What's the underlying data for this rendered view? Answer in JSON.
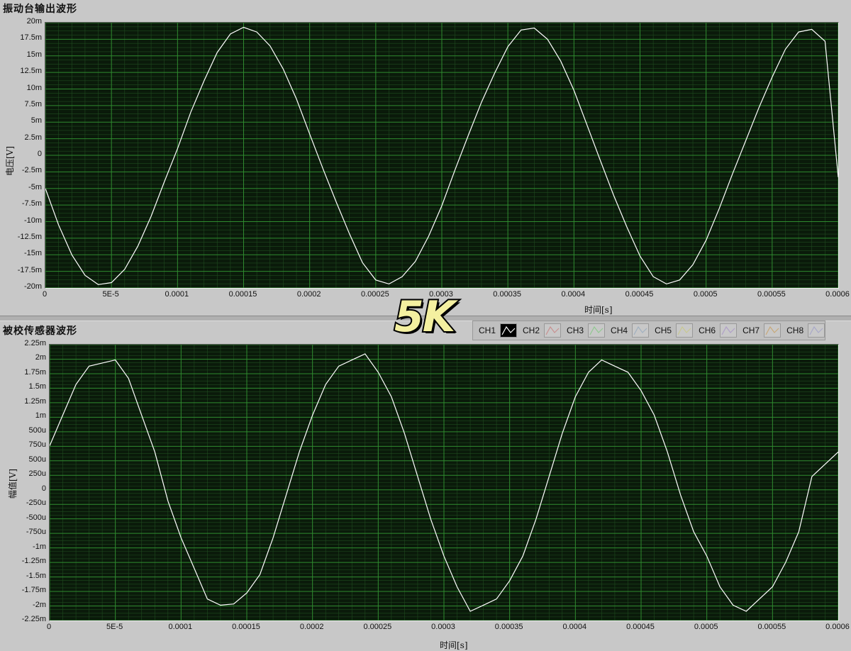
{
  "chart_data": [
    {
      "type": "line",
      "title": "振动台输出波形",
      "xlabel": "时间[s]",
      "ylabel": "电压[V]",
      "xlim": [
        0,
        0.0006
      ],
      "ylim": [
        -0.02,
        0.02
      ],
      "xticks": [
        "0",
        "5E-5",
        "0.0001",
        "0.00015",
        "0.0002",
        "0.00025",
        "0.0003",
        "0.00035",
        "0.0004",
        "0.00045",
        "0.0005",
        "0.00055",
        "0.0006"
      ],
      "yticks": [
        "20m",
        "17.5m",
        "15m",
        "12.5m",
        "10m",
        "7.5m",
        "5m",
        "2.5m",
        "0",
        "-2.5m",
        "-5m",
        "-7.5m",
        "-10m",
        "-12.5m",
        "-15m",
        "-17.5m",
        "-20m"
      ],
      "grid": true,
      "series": [
        {
          "color": "#ffffff",
          "x": [
            0,
            1e-05,
            2e-05,
            3e-05,
            4e-05,
            5e-05,
            6e-05,
            7e-05,
            8e-05,
            9e-05,
            0.0001,
            0.00011,
            0.00012,
            0.00013,
            0.00014,
            0.00015,
            0.00016,
            0.00017,
            0.00018,
            0.00019,
            0.0002,
            0.00021,
            0.00022,
            0.00023,
            0.00024,
            0.00025,
            0.00026,
            0.00027,
            0.00028,
            0.00029,
            0.0003,
            0.00031,
            0.00032,
            0.00033,
            0.00034,
            0.00035,
            0.00036,
            0.00037,
            0.00038,
            0.00039,
            0.0004,
            0.00041,
            0.00042,
            0.00043,
            0.00044,
            0.00045,
            0.00046,
            0.00047,
            0.00048,
            0.00049,
            0.0005,
            0.00051,
            0.00052,
            0.00053,
            0.00054,
            0.00055,
            0.00056,
            0.00057,
            0.00058,
            0.00059,
            0.0006
          ],
          "values": [
            -0.005,
            -0.0105,
            -0.015,
            -0.0181,
            -0.0195,
            -0.0192,
            -0.0172,
            -0.0137,
            -0.0092,
            -0.004,
            0.001,
            0.0065,
            0.0112,
            0.0155,
            0.0183,
            0.0193,
            0.0186,
            0.0165,
            0.013,
            0.0085,
            0.0032,
            -0.002,
            -0.007,
            -0.0118,
            -0.0162,
            -0.0188,
            -0.0194,
            -0.0183,
            -0.016,
            -0.0122,
            -0.0076,
            -0.0022,
            0.003,
            0.008,
            0.0124,
            0.0164,
            0.0189,
            0.0192,
            0.0175,
            0.0142,
            0.0098,
            0.0045,
            -0.0008,
            -0.006,
            -0.0108,
            -0.0152,
            -0.0183,
            -0.0194,
            -0.0188,
            -0.0165,
            -0.0128,
            -0.008,
            -0.0028,
            0.0022,
            0.0072,
            0.0118,
            0.016,
            0.0186,
            0.019,
            0.0172,
            -0.0033
          ]
        }
      ]
    },
    {
      "type": "line",
      "title": "被校传感器波形",
      "xlabel": "时间[s]",
      "ylabel": "幅值[V]",
      "xlim": [
        0,
        0.0006
      ],
      "ylim": [
        -0.00225,
        0.00225
      ],
      "xticks": [
        "0",
        "5E-5",
        "0.0001",
        "0.00015",
        "0.0002",
        "0.00025",
        "0.0003",
        "0.00035",
        "0.0004",
        "0.00045",
        "0.0005",
        "0.00055",
        "0.0006"
      ],
      "yticks": [
        "2.25m",
        "2m",
        "1.75m",
        "1.5m",
        "1.25m",
        "1m",
        "500u",
        "750u",
        "500u",
        "250u",
        "0",
        "-250u",
        "-500u",
        "-750u",
        "-1m",
        "-1.25m",
        "-1.5m",
        "-1.75m",
        "-2m",
        "-2.25m"
      ],
      "grid": true,
      "series": [
        {
          "color": "#ffffff",
          "x": [
            0,
            1e-05,
            2e-05,
            3e-05,
            4e-05,
            5e-05,
            6e-05,
            7e-05,
            8e-05,
            9e-05,
            0.0001,
            0.00011,
            0.00012,
            0.00013,
            0.00014,
            0.00015,
            0.00016,
            0.00017,
            0.00018,
            0.00019,
            0.0002,
            0.00021,
            0.00022,
            0.00023,
            0.00024,
            0.00025,
            0.00026,
            0.00027,
            0.00028,
            0.00029,
            0.0003,
            0.00031,
            0.00032,
            0.00033,
            0.00034,
            0.00035,
            0.00036,
            0.00037,
            0.00038,
            0.00039,
            0.0004,
            0.00041,
            0.00042,
            0.00043,
            0.00044,
            0.00045,
            0.00046,
            0.00047,
            0.00048,
            0.00049,
            0.0005,
            0.00051,
            0.00052,
            0.00053,
            0.00054,
            0.00055,
            0.00056,
            0.00057,
            0.00058,
            0.00059,
            0.0006
          ],
          "values": [
            0.0006,
            0.0011,
            0.0016,
            0.0019,
            0.00195,
            0.002,
            0.0017,
            0.0011,
            0.0005,
            -0.0003,
            -0.0009,
            -0.0014,
            -0.0019,
            -0.002,
            -0.00198,
            -0.0018,
            -0.0015,
            -0.0009,
            -0.0002,
            0.0005,
            0.0011,
            0.0016,
            0.0019,
            0.002,
            0.0021,
            0.0018,
            0.0014,
            0.0008,
            0.0001,
            -0.0006,
            -0.0012,
            -0.0017,
            -0.0021,
            -0.002,
            -0.0019,
            -0.0016,
            -0.0012,
            -0.0006,
            0.0001,
            0.0008,
            0.0014,
            0.0018,
            0.002,
            0.0019,
            0.0018,
            0.0015,
            0.0011,
            0.0005,
            -0.0002,
            -0.0008,
            -0.0012,
            -0.0017,
            -0.002,
            -0.0021,
            -0.0019,
            -0.0017,
            -0.0013,
            -0.0008,
            0.0001,
            0.0003,
            0.0005
          ]
        }
      ]
    }
  ],
  "badge": "5K",
  "legend": [
    {
      "label": "CH1",
      "color": "#000000"
    },
    {
      "label": "CH2",
      "color": "#c89090"
    },
    {
      "label": "CH3",
      "color": "#90c890"
    },
    {
      "label": "CH4",
      "color": "#a0b0c0"
    },
    {
      "label": "CH5",
      "color": "#c8c890"
    },
    {
      "label": "CH6",
      "color": "#b0a0c8"
    },
    {
      "label": "CH7",
      "color": "#c8a878"
    },
    {
      "label": "CH8",
      "color": "#a8a8c8"
    }
  ]
}
